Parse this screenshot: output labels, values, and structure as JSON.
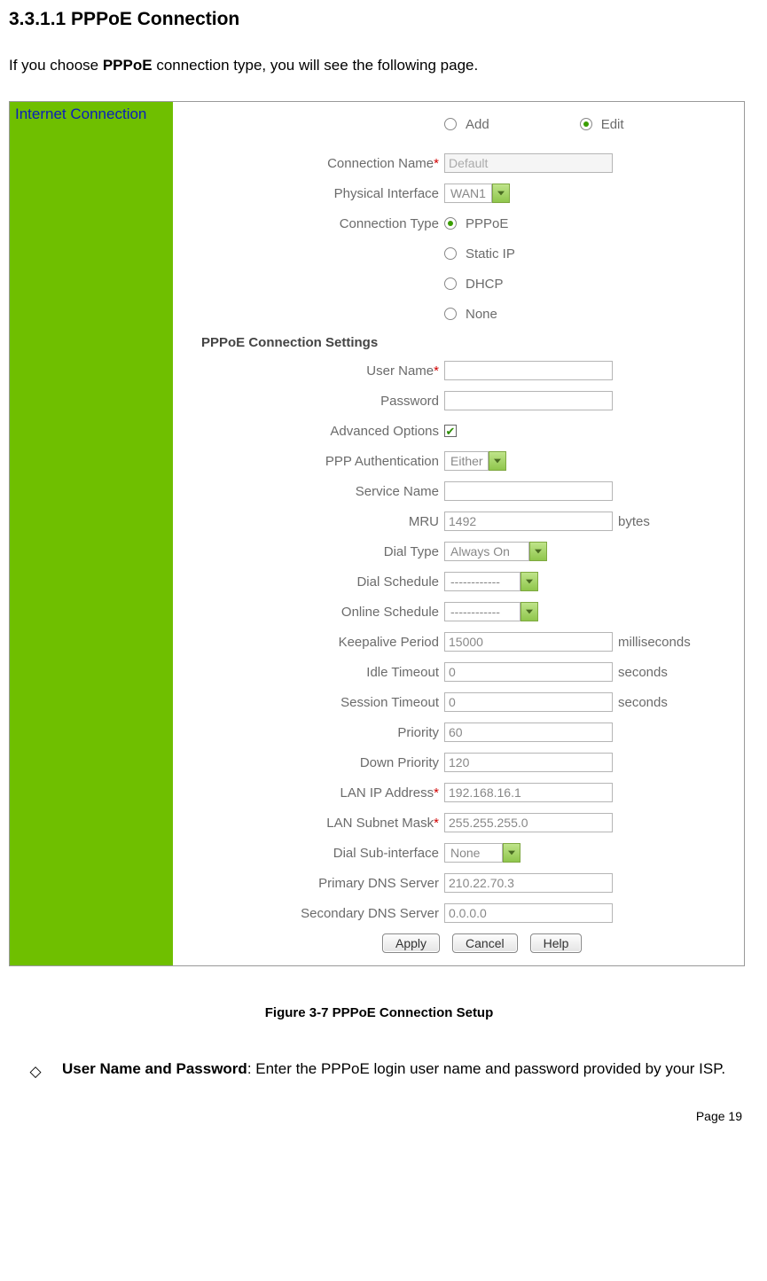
{
  "heading": "3.3.1.1  PPPoE Connection",
  "intro_pre": "If you choose ",
  "intro_bold": "PPPoE",
  "intro_post": " connection type, you will see the following page.",
  "sidebar_title": "Internet Connection",
  "top": {
    "add_label": "Add",
    "edit_label": "Edit"
  },
  "fields": {
    "connection_name": {
      "label": "Connection Name",
      "value": "Default"
    },
    "physical_if": {
      "label": "Physical Interface",
      "value": "WAN1"
    },
    "conn_type": {
      "label": "Connection Type",
      "options": [
        "PPPoE",
        "Static IP",
        "DHCP",
        "None"
      ],
      "selected": "PPPoE"
    }
  },
  "pppoe_section_title": "PPPoE Connection Settings",
  "pppoe": {
    "user": {
      "label": "User Name",
      "value": ""
    },
    "pass": {
      "label": "Password",
      "value": ""
    },
    "adv": {
      "label": "Advanced Options",
      "checked": true
    },
    "auth": {
      "label": "PPP Authentication",
      "value": "Either"
    },
    "service": {
      "label": "Service Name",
      "value": ""
    },
    "mru": {
      "label": "MRU",
      "value": "1492",
      "unit": "bytes"
    },
    "dial": {
      "label": "Dial Type",
      "value": "Always On"
    },
    "dsched": {
      "label": "Dial Schedule",
      "value": "------------"
    },
    "osched": {
      "label": "Online Schedule",
      "value": "------------"
    },
    "keep": {
      "label": "Keepalive Period",
      "value": "15000",
      "unit": "milliseconds"
    },
    "idle": {
      "label": "Idle Timeout",
      "value": "0",
      "unit": "seconds"
    },
    "sess": {
      "label": "Session Timeout",
      "value": "0",
      "unit": "seconds"
    },
    "prio": {
      "label": "Priority",
      "value": "60"
    },
    "dprio": {
      "label": "Down Priority",
      "value": "120"
    },
    "lanip": {
      "label": "LAN IP Address",
      "value": "192.168.16.1"
    },
    "mask": {
      "label": "LAN Subnet Mask",
      "value": "255.255.255.0"
    },
    "dsub": {
      "label": "Dial Sub-interface",
      "value": "None"
    },
    "dns1": {
      "label": "Primary DNS Server",
      "value": "210.22.70.3"
    },
    "dns2": {
      "label": "Secondary DNS Server",
      "value": "0.0.0.0"
    }
  },
  "buttons": {
    "apply": "Apply",
    "cancel": "Cancel",
    "help": "Help"
  },
  "figure_caption": "Figure 3-7 PPPoE Connection Setup",
  "desc": {
    "term": "User Name and Password",
    "body": ": Enter the PPPoE login user name and password provided by your ISP."
  },
  "page_label": "Page  19"
}
